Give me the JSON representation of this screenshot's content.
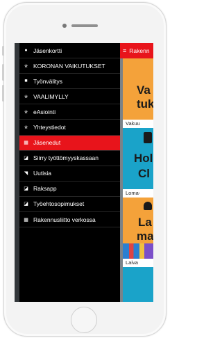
{
  "menu": {
    "items": [
      {
        "label": "Jäsenkortti",
        "icon": "person-icon",
        "glyph": "●"
      },
      {
        "label": "KORONAN VAIKUTUKSET",
        "icon": "star-icon",
        "glyph": "✯"
      },
      {
        "label": "Työnvälitys",
        "icon": "lock-icon",
        "glyph": "■"
      },
      {
        "label": "VAALIMYLLY",
        "icon": "star-icon",
        "glyph": "✯"
      },
      {
        "label": "eAsiointi",
        "icon": "star-icon",
        "glyph": "✯"
      },
      {
        "label": "Yhteystiedot",
        "icon": "star-icon",
        "glyph": "✯"
      },
      {
        "label": "Jäsenedut",
        "icon": "grid-icon",
        "glyph": "▦",
        "active": true
      },
      {
        "label": "Siirry työttömyyskassaan",
        "icon": "external-link-icon",
        "glyph": "◪"
      },
      {
        "label": "Uutisia",
        "icon": "rss-icon",
        "glyph": "◥"
      },
      {
        "label": "Raksapp",
        "icon": "external-link-icon",
        "glyph": "◪"
      },
      {
        "label": "Työehtosopimukset",
        "icon": "external-link-icon",
        "glyph": "◪"
      },
      {
        "label": "Rakennusliitto verkossa",
        "icon": "grid-icon",
        "glyph": "▦"
      }
    ]
  },
  "panel": {
    "header_title": "Rakenn",
    "menu_glyph": "≡",
    "cards": [
      {
        "big1": "Va",
        "big2": "tuk",
        "caption": "Vakuu",
        "bg": "#f4a23a"
      },
      {
        "big1": "Hol",
        "big2": "Cl",
        "caption": "Loma-",
        "bg": "#1aa3c9"
      },
      {
        "big1": "La",
        "big2": "ma",
        "caption": "Laiva",
        "bg": "#f4a23a"
      }
    ]
  },
  "colors": {
    "accent": "#e8141b",
    "menu_bg": "#000000",
    "orange": "#f4a23a",
    "teal": "#1aa3c9"
  }
}
